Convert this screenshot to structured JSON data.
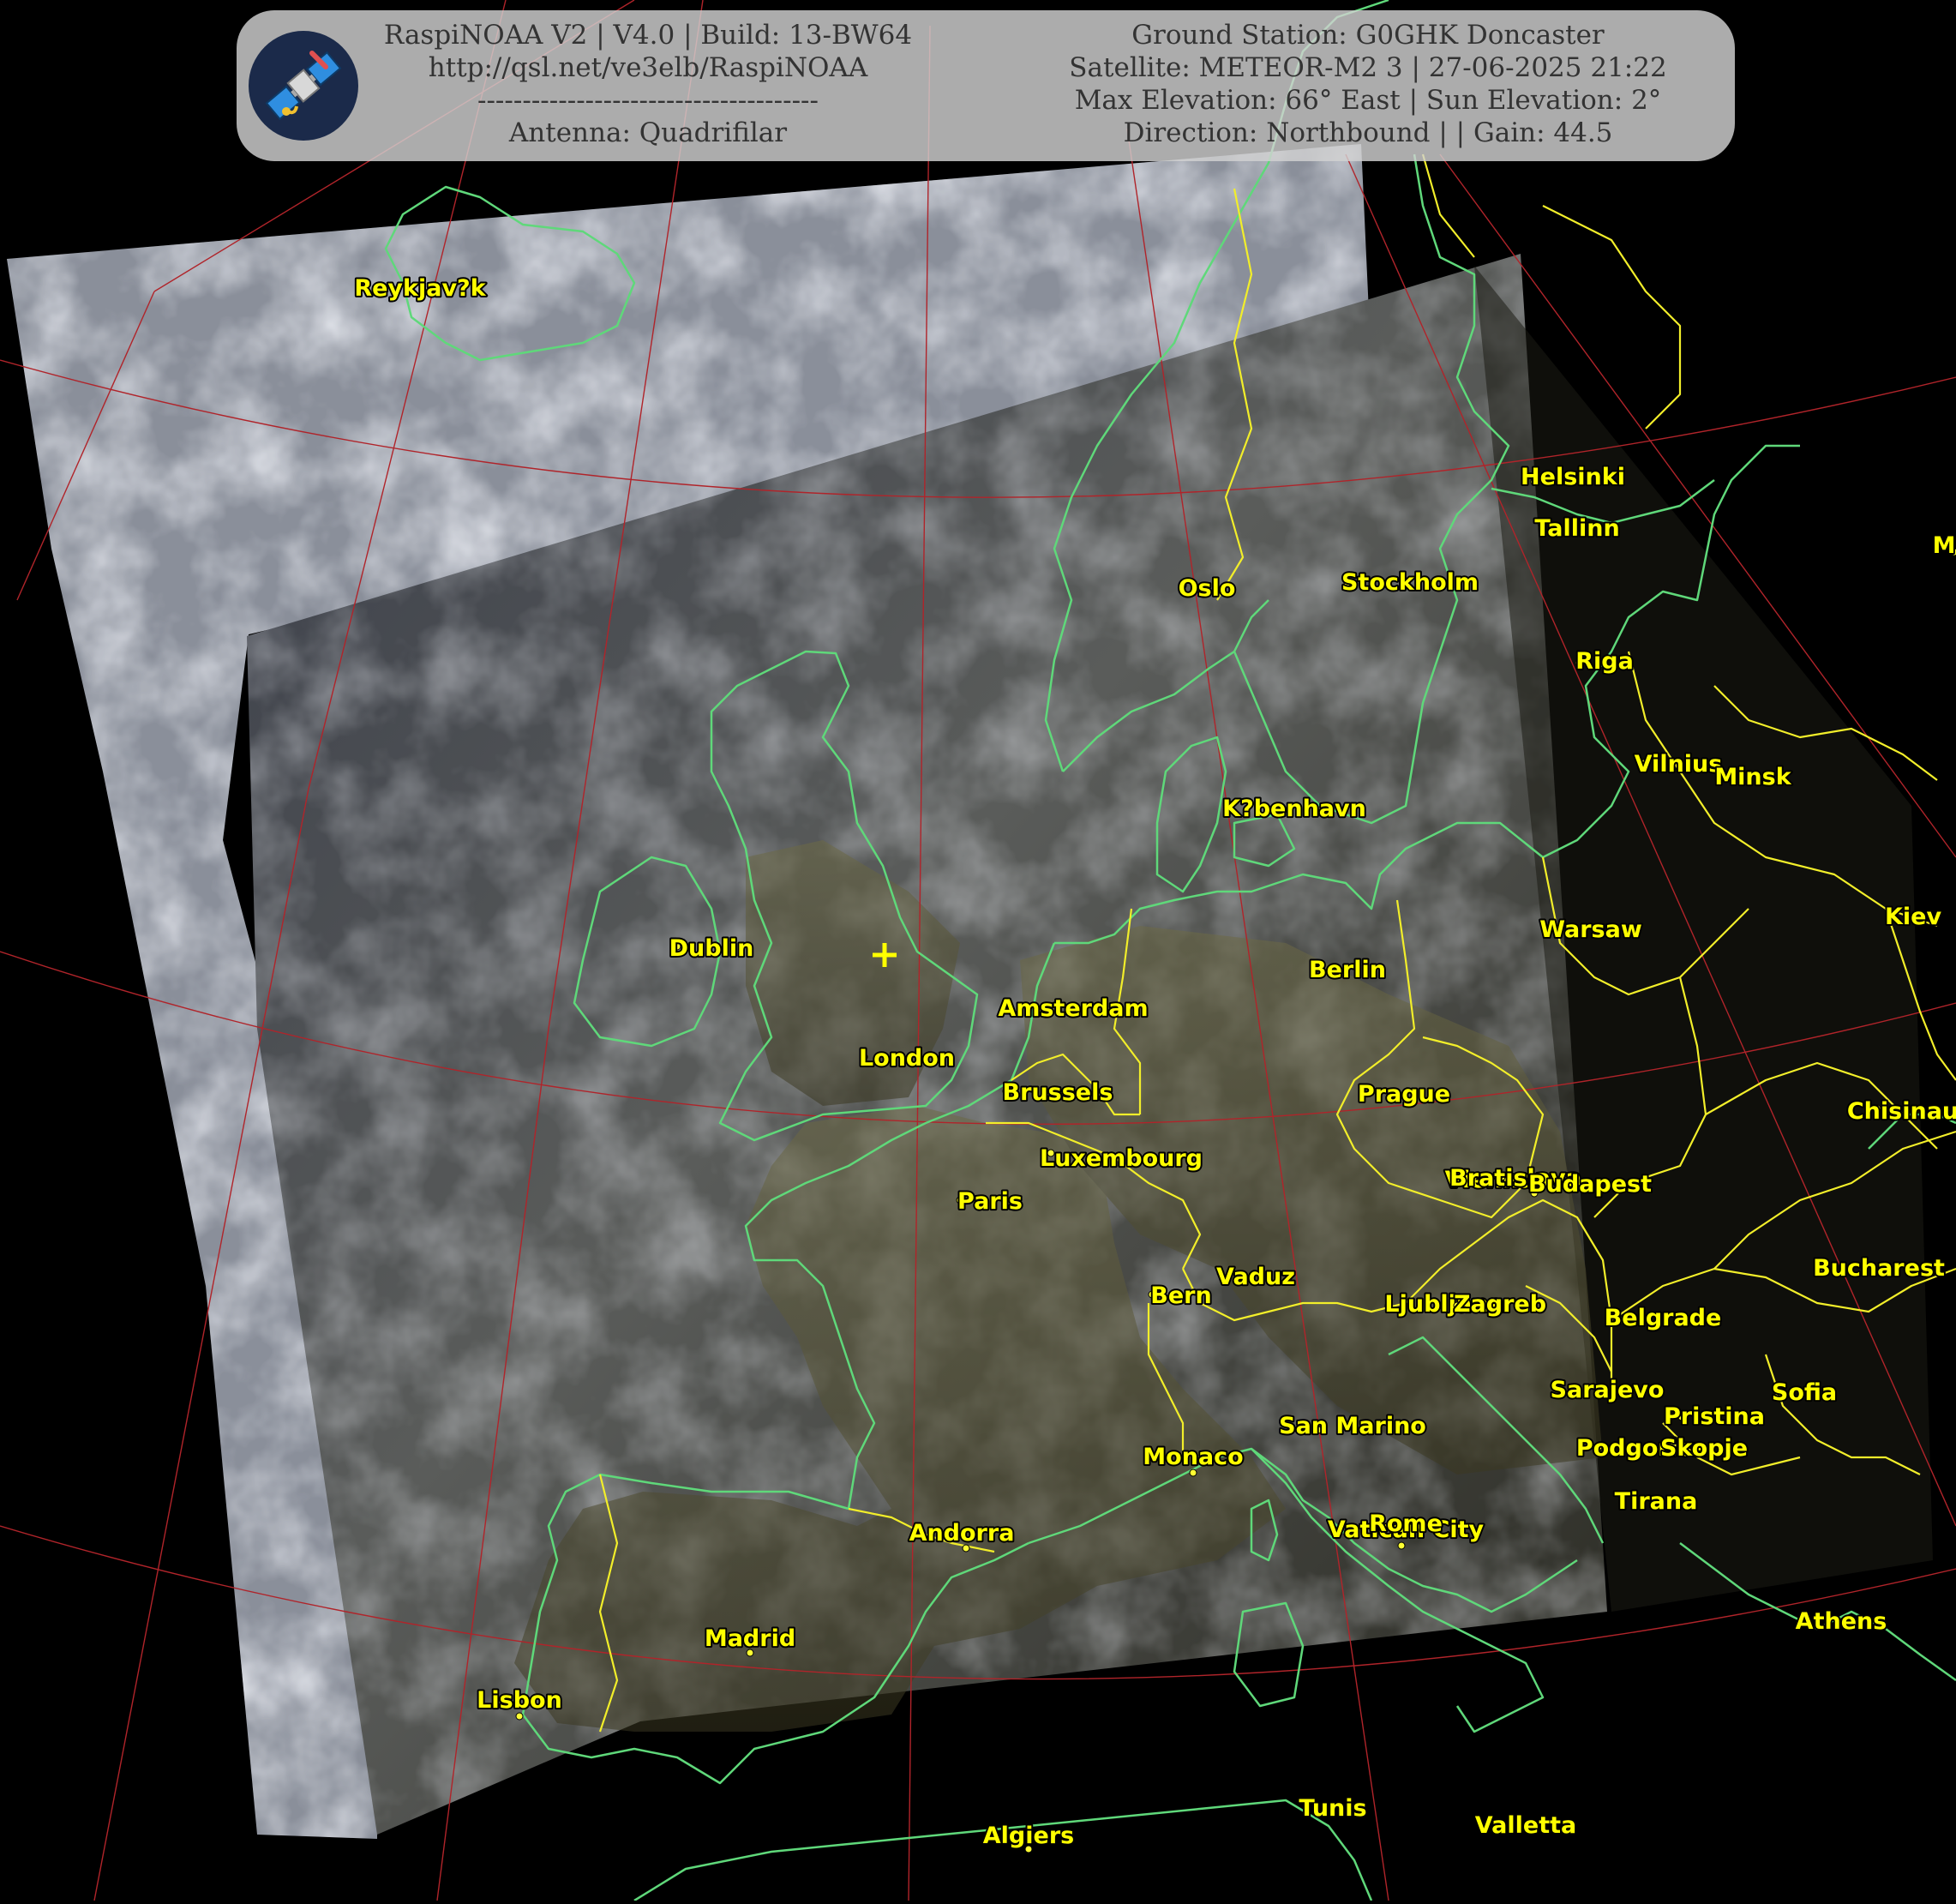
{
  "header": {
    "left_lines": [
      "RaspiNOAA V2 | V4.0 | Build: 13-BW64",
      "http://qsl.net/ve3elb/RaspiNOAA",
      "--------------------------------------",
      "Antenna: Quadrifilar"
    ],
    "right_lines": [
      "Ground Station: G0GHK Doncaster",
      "Satellite: METEOR-M2 3 | 27-06-2025 21:22",
      "Max Elevation: 66° East | Sun Elevation: 2°",
      "Direction: Northbound | | Gain: 44.5"
    ],
    "logo_icon": "satellite-icon"
  },
  "colors": {
    "coastline": "#5fd87a",
    "borders": "#f2ee2a",
    "graticule": "#b0242a",
    "labels": "#ffff00",
    "panel": "#d2d2d2"
  },
  "ground_station_marker": "+",
  "cities": [
    {
      "name": "Reykjav?k"
    },
    {
      "name": "Helsinki"
    },
    {
      "name": "Tallinn"
    },
    {
      "name": "Oslo"
    },
    {
      "name": "Stockholm"
    },
    {
      "name": "Riga"
    },
    {
      "name": "Vilnius"
    },
    {
      "name": "Minsk"
    },
    {
      "name": "K?benhavn"
    },
    {
      "name": "Dublin"
    },
    {
      "name": "Warsaw"
    },
    {
      "name": "Kiev"
    },
    {
      "name": "Berlin"
    },
    {
      "name": "Amsterdam"
    },
    {
      "name": "London"
    },
    {
      "name": "Brussels"
    },
    {
      "name": "Prague"
    },
    {
      "name": "Chisinau"
    },
    {
      "name": "Luxembourg"
    },
    {
      "name": "Vienna"
    },
    {
      "name": "Bratislava"
    },
    {
      "name": "Budapest"
    },
    {
      "name": "Paris"
    },
    {
      "name": "Bucharest"
    },
    {
      "name": "Vaduz"
    },
    {
      "name": "Bern"
    },
    {
      "name": "Ljubljana"
    },
    {
      "name": "Zagreb"
    },
    {
      "name": "Belgrade"
    },
    {
      "name": "Sarajevo"
    },
    {
      "name": "Sofia"
    },
    {
      "name": "San Marino"
    },
    {
      "name": "Pristina"
    },
    {
      "name": "Podgorica"
    },
    {
      "name": "Skopje"
    },
    {
      "name": "Monaco"
    },
    {
      "name": "Tirana"
    },
    {
      "name": "Andorra"
    },
    {
      "name": "Vatican City"
    },
    {
      "name": "Rome"
    },
    {
      "name": "Madrid"
    },
    {
      "name": "Lisbon"
    },
    {
      "name": "Athens"
    },
    {
      "name": "Tunis"
    },
    {
      "name": "Valletta"
    },
    {
      "name": "Algiers"
    },
    {
      "name": "M"
    }
  ]
}
